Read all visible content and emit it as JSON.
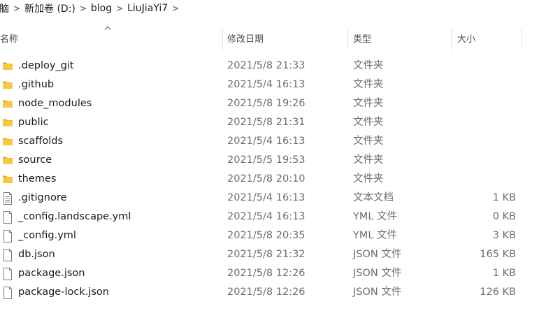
{
  "breadcrumb": {
    "items": [
      "脑",
      "新加卷 (D:)",
      "blog",
      "LiuJiaYi7"
    ],
    "separator": ">"
  },
  "columns": {
    "name": "名称",
    "date": "修改日期",
    "type": "类型",
    "size": "大小"
  },
  "sort": {
    "column": "name",
    "direction": "ascending"
  },
  "files": [
    {
      "name": ".deploy_git",
      "date": "2021/5/8 21:33",
      "type": "文件夹",
      "size": "",
      "icon": "folder-icon"
    },
    {
      "name": ".github",
      "date": "2021/5/4 16:13",
      "type": "文件夹",
      "size": "",
      "icon": "folder-icon"
    },
    {
      "name": "node_modules",
      "date": "2021/5/8 19:26",
      "type": "文件夹",
      "size": "",
      "icon": "folder-icon"
    },
    {
      "name": "public",
      "date": "2021/5/8 21:31",
      "type": "文件夹",
      "size": "",
      "icon": "folder-icon"
    },
    {
      "name": "scaffolds",
      "date": "2021/5/4 16:13",
      "type": "文件夹",
      "size": "",
      "icon": "folder-icon"
    },
    {
      "name": "source",
      "date": "2021/5/5 19:53",
      "type": "文件夹",
      "size": "",
      "icon": "folder-icon"
    },
    {
      "name": "themes",
      "date": "2021/5/8 20:10",
      "type": "文件夹",
      "size": "",
      "icon": "folder-icon"
    },
    {
      "name": ".gitignore",
      "date": "2021/5/4 16:13",
      "type": "文本文档",
      "size": "1 KB",
      "icon": "text-file-icon"
    },
    {
      "name": "_config.landscape.yml",
      "date": "2021/5/4 16:13",
      "type": "YML 文件",
      "size": "0 KB",
      "icon": "file-icon"
    },
    {
      "name": "_config.yml",
      "date": "2021/5/8 20:35",
      "type": "YML 文件",
      "size": "3 KB",
      "icon": "file-icon"
    },
    {
      "name": "db.json",
      "date": "2021/5/8 21:32",
      "type": "JSON 文件",
      "size": "165 KB",
      "icon": "file-icon"
    },
    {
      "name": "package.json",
      "date": "2021/5/8 12:26",
      "type": "JSON 文件",
      "size": "1 KB",
      "icon": "file-icon"
    },
    {
      "name": "package-lock.json",
      "date": "2021/5/8 12:26",
      "type": "JSON 文件",
      "size": "126 KB",
      "icon": "file-icon"
    }
  ],
  "colors": {
    "folder": "#f8c843",
    "folder_tab": "#e3a92a",
    "header_text": "#4d4d4d",
    "secondary_text": "#6d6d6d"
  }
}
